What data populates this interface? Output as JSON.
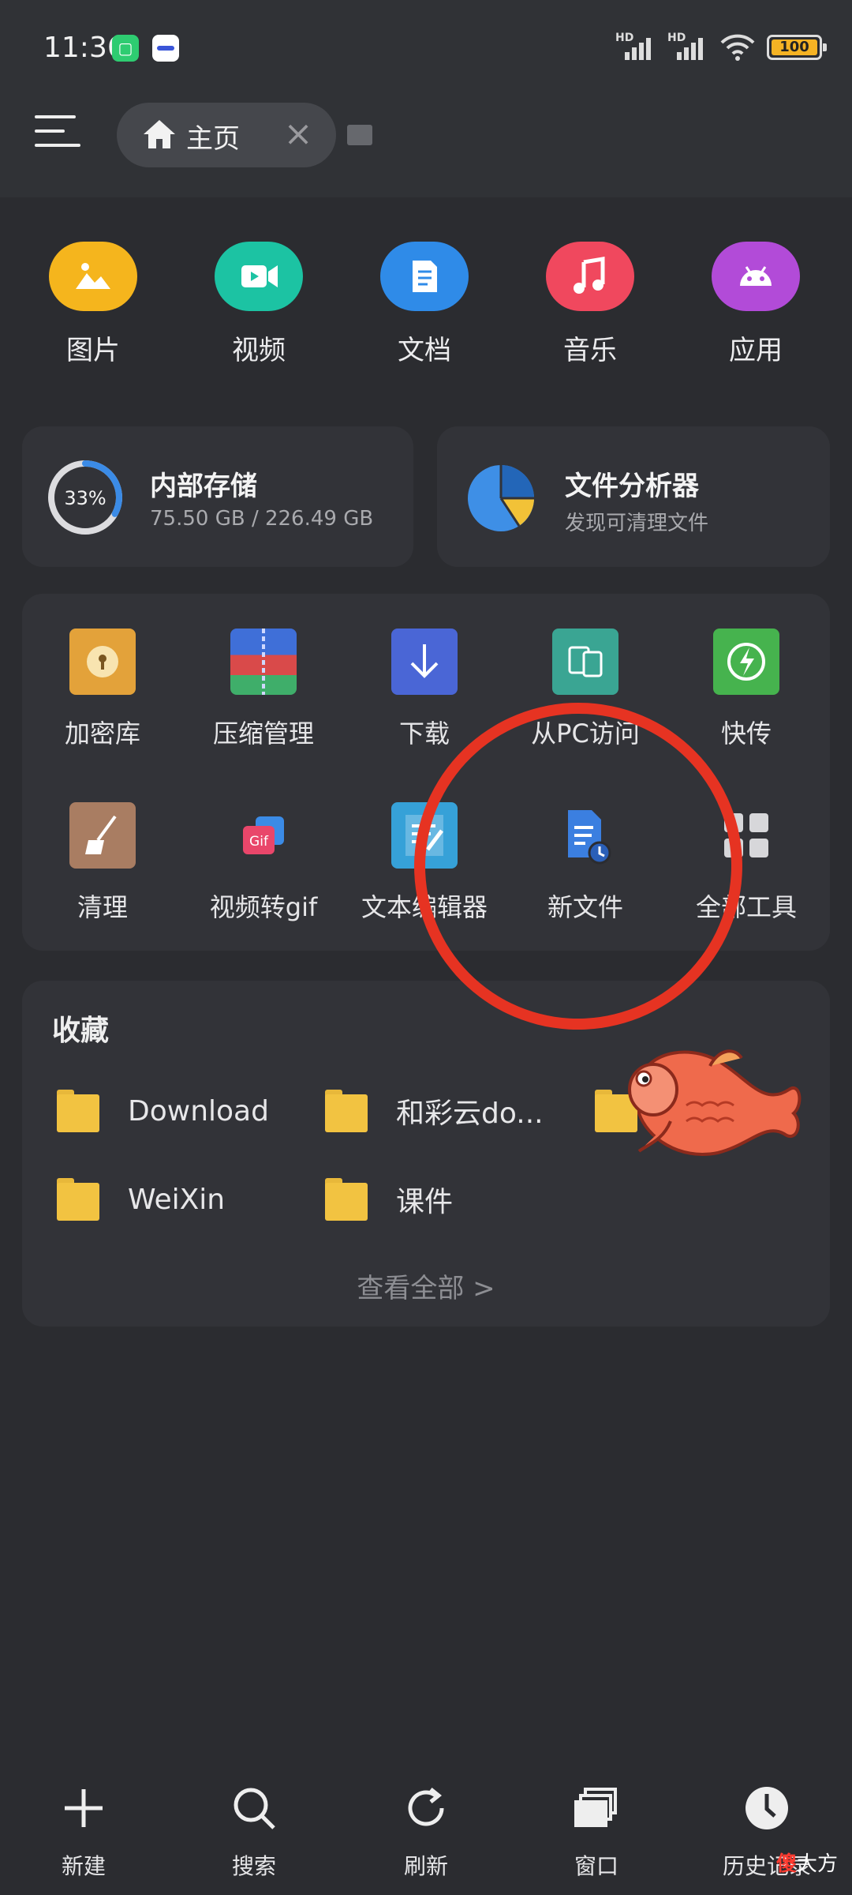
{
  "status": {
    "time": "11:36",
    "net_label": "HD",
    "battery": "100"
  },
  "toolbar": {
    "tab_label": "主页"
  },
  "categories": [
    {
      "label": "图片",
      "icon": "image-icon",
      "color": "#f5b51d"
    },
    {
      "label": "视频",
      "icon": "video-icon",
      "color": "#1cc3a3"
    },
    {
      "label": "文档",
      "icon": "document-icon",
      "color": "#2f8be8"
    },
    {
      "label": "音乐",
      "icon": "music-icon",
      "color": "#f0485e"
    },
    {
      "label": "应用",
      "icon": "android-icon",
      "color": "#b24bd8"
    }
  ],
  "storage": {
    "percent_label": "33%",
    "percent": 33,
    "title": "内部存储",
    "usage": "75.50 GB / 226.49 GB"
  },
  "analyzer": {
    "title": "文件分析器",
    "subtitle": "发现可清理文件"
  },
  "tools": [
    {
      "label": "加密库",
      "icon": "vault-icon"
    },
    {
      "label": "压缩管理",
      "icon": "archive-icon"
    },
    {
      "label": "下载",
      "icon": "download-icon"
    },
    {
      "label": "从PC访问",
      "icon": "pc-access-icon"
    },
    {
      "label": "快传",
      "icon": "quick-transfer-icon"
    },
    {
      "label": "清理",
      "icon": "broom-icon"
    },
    {
      "label": "视频转gif",
      "icon": "gif-icon"
    },
    {
      "label": "文本编辑器",
      "icon": "text-editor-icon"
    },
    {
      "label": "新文件",
      "icon": "new-file-icon"
    },
    {
      "label": "全部工具",
      "icon": "all-tools-icon"
    }
  ],
  "favorites": {
    "title": "收藏",
    "items": [
      "Download",
      "和彩云do...",
      "WeiXin",
      "课件"
    ],
    "see_all": "查看全部 >"
  },
  "bottom_nav": [
    {
      "label": "新建",
      "icon": "plus-icon"
    },
    {
      "label": "搜索",
      "icon": "search-icon"
    },
    {
      "label": "刷新",
      "icon": "refresh-icon"
    },
    {
      "label": "窗口",
      "icon": "windows-icon"
    },
    {
      "label": "历史记录",
      "icon": "clock-icon"
    }
  ],
  "watermark": {
    "accent": "傻",
    "rest": "大方"
  }
}
